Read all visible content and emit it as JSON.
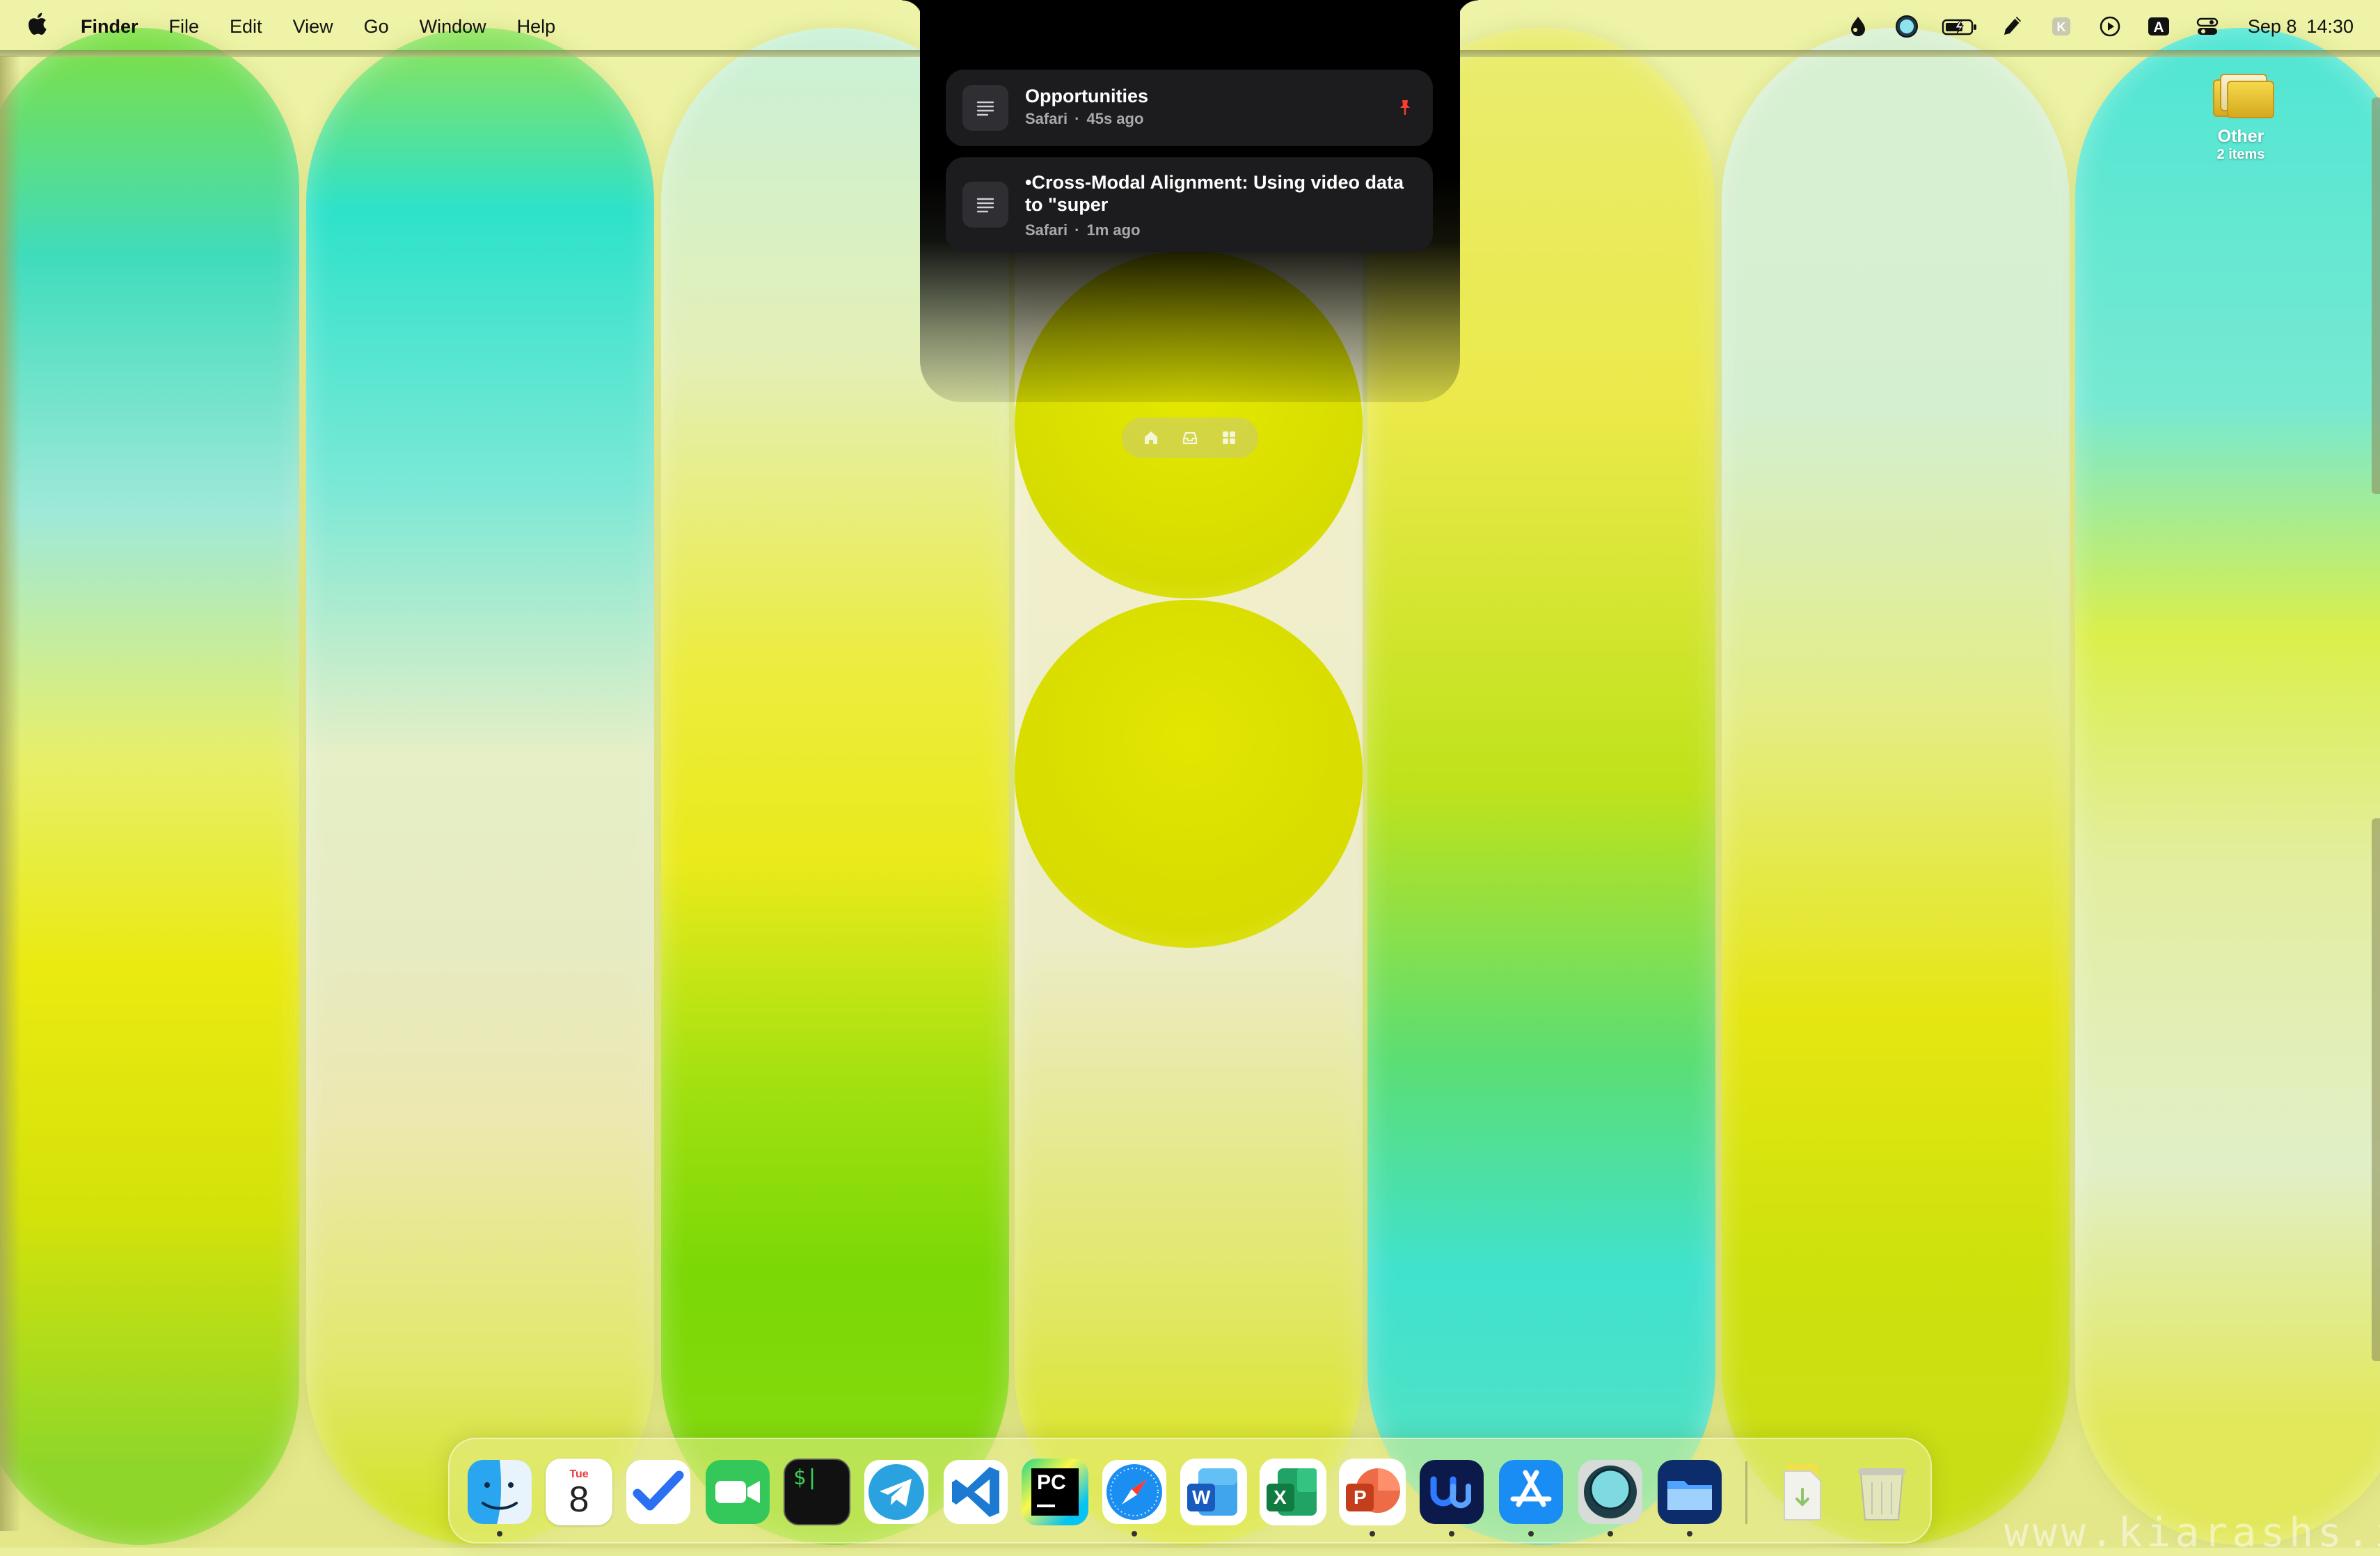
{
  "menubar": {
    "apple_icon": "apple-icon",
    "app_name": "Finder",
    "menus": [
      "File",
      "Edit",
      "View",
      "Go",
      "Window",
      "Help"
    ],
    "status_icons": [
      "drop-icon",
      "moon-circle-icon",
      "battery-icon",
      "brush-icon",
      "k-icon",
      "play-icon",
      "a-keyboard-icon",
      "control-center-icon"
    ],
    "date": "Sep 8",
    "time": "14:30"
  },
  "notch": {
    "items": [
      {
        "title": "Opportunities",
        "app": "Safari",
        "age": "45s ago",
        "pinned": true
      },
      {
        "title": "•Cross-Modal Alignment: Using video data to \"super",
        "app": "Safari",
        "age": "1m ago",
        "pinned": false
      }
    ],
    "tabs": [
      "home-icon",
      "tray-icon",
      "grid-icon"
    ],
    "accent_pin_color": "#ff3b30"
  },
  "desktop": {
    "folder": {
      "name": "Other",
      "count": "2 items"
    }
  },
  "dock": {
    "apps": [
      {
        "name": "Finder",
        "icon": "finder-icon",
        "running": true
      },
      {
        "name": "Calendar",
        "icon": "calendar-icon",
        "day": "Tue",
        "date": "8",
        "running": false
      },
      {
        "name": "Tasks",
        "icon": "checkmark-icon",
        "running": false
      },
      {
        "name": "FaceTime",
        "icon": "video-camera-icon",
        "running": false
      },
      {
        "name": "Terminal",
        "icon": "terminal-icon",
        "glyph": "$|",
        "running": false
      },
      {
        "name": "Telegram",
        "icon": "telegram-icon",
        "running": false
      },
      {
        "name": "Visual Studio Code",
        "icon": "vscode-icon",
        "running": false
      },
      {
        "name": "PyCharm",
        "icon": "pycharm-icon",
        "glyph": "PC",
        "running": false
      },
      {
        "name": "Safari",
        "icon": "compass-icon",
        "running": true
      },
      {
        "name": "Word",
        "icon": "word-icon",
        "glyph": "W",
        "running": false
      },
      {
        "name": "Excel",
        "icon": "excel-icon",
        "glyph": "X",
        "running": false
      },
      {
        "name": "PowerPoint",
        "icon": "powerpoint-icon",
        "glyph": "P",
        "running": true
      },
      {
        "name": "Notchnook",
        "icon": "u-logo-icon",
        "running": true
      },
      {
        "name": "App Store",
        "icon": "app-store-icon",
        "running": true
      },
      {
        "name": "Focus App",
        "icon": "circle-lens-icon",
        "running": true
      },
      {
        "name": "Files",
        "icon": "folder-icon",
        "running": true
      },
      {
        "name": "Downloads",
        "icon": "downloads-stack-icon",
        "running": false
      },
      {
        "name": "Trash",
        "icon": "trash-icon",
        "running": false
      }
    ]
  },
  "watermark": "www.kiarashs.ir"
}
